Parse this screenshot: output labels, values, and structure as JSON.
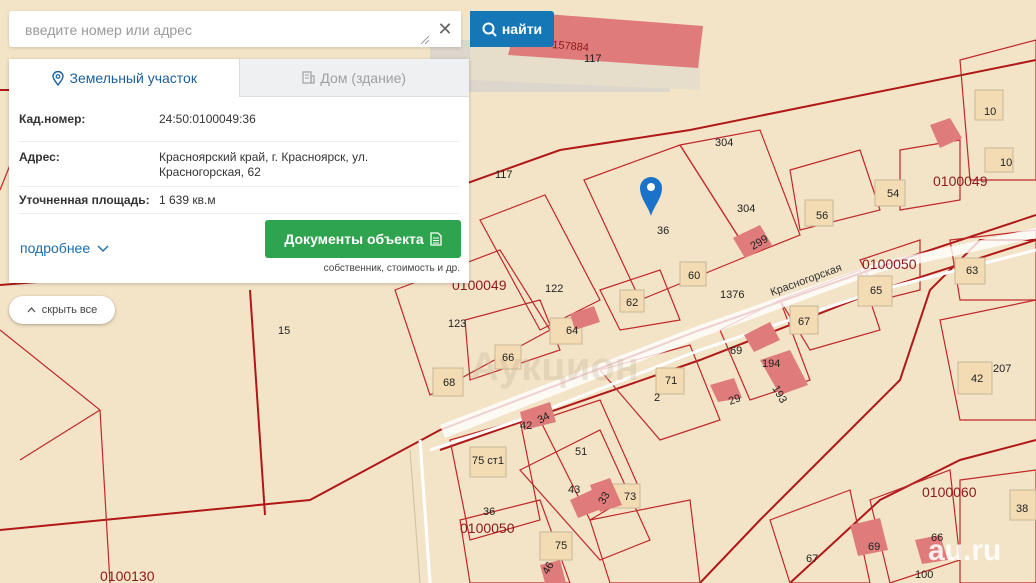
{
  "search": {
    "placeholder": "введите номер или адрес",
    "find_label": "найти"
  },
  "tabs": {
    "land": "Земельный участок",
    "building": "Дом (здание)"
  },
  "details": {
    "cad_label": "Кад.номер:",
    "cad_value": "24:50:0100049:36",
    "address_label": "Адрес:",
    "address_line1": "Красноярский край, г. Красноярск, ул.",
    "address_line2": "Красногорская, 62",
    "area_label": "Уточненная площадь:",
    "area_value": "1 639 кв.м"
  },
  "card": {
    "more_label": "подробнее",
    "docs_label": "Документы объекта",
    "docs_sub": "собственник, стоимость и др."
  },
  "hide_all_label": "скрыть все",
  "map": {
    "street": "Красногорская",
    "quarters": [
      "0100049",
      "0100049",
      "0100050",
      "0100050",
      "0100060",
      "0100130"
    ],
    "parcels": [
      "157884",
      "117",
      "117",
      "304",
      "304",
      "36",
      "10",
      "10",
      "54",
      "56",
      "299",
      "60",
      "62",
      "1376",
      "65",
      "67",
      "63",
      "122",
      "123",
      "64",
      "66",
      "68",
      "15",
      "71",
      "2",
      "69",
      "194",
      "29",
      "193",
      "42",
      "207",
      "42",
      "34",
      "51",
      "75 ст1",
      "43",
      "33",
      "73",
      "36",
      "75",
      "46",
      "69",
      "66",
      "67",
      "38",
      "100"
    ],
    "watermark": "au.ru",
    "pin_color": "#1a73c9"
  }
}
